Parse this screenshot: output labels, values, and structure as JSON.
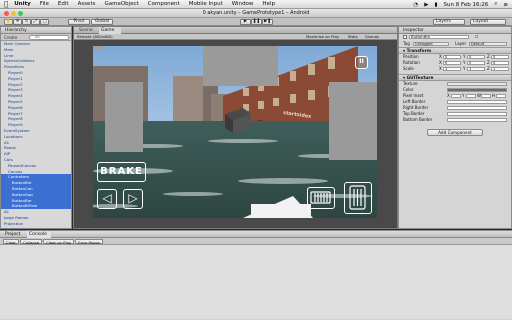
{
  "menubar": {
    "items": [
      "Unity",
      "File",
      "Edit",
      "Assets",
      "GameObject",
      "Component",
      "Mobile Input",
      "Window",
      "Help"
    ],
    "clock": "Sun 8 Feb 16:26"
  },
  "window": {
    "title": "0 akyan.unity – GamePrototype1 – Android"
  },
  "toolbar": {
    "pivot_label": "Pivot",
    "global_label": "Global",
    "layers_label": "Layers",
    "layout_label": "Layout"
  },
  "hierarchy": {
    "tab": "Hierarchy",
    "create_label": "Create",
    "search_placeholder": "All",
    "items": [
      {
        "label": "Main Camera",
        "indent": 0,
        "selected": false
      },
      {
        "label": "Main",
        "indent": 0,
        "selected": false
      },
      {
        "label": "Lime",
        "indent": 0,
        "selected": false
      },
      {
        "label": "SphereColliders",
        "indent": 0,
        "selected": false
      },
      {
        "label": "Planetlans",
        "indent": 0,
        "selected": false
      },
      {
        "label": "Player0",
        "indent": 1,
        "selected": false
      },
      {
        "label": "Player1",
        "indent": 1,
        "selected": false
      },
      {
        "label": "Player2",
        "indent": 1,
        "selected": false
      },
      {
        "label": "Player3",
        "indent": 1,
        "selected": false
      },
      {
        "label": "Player4",
        "indent": 1,
        "selected": false
      },
      {
        "label": "Player5",
        "indent": 1,
        "selected": false
      },
      {
        "label": "Player6",
        "indent": 1,
        "selected": false
      },
      {
        "label": "Player7",
        "indent": 1,
        "selected": false
      },
      {
        "label": "Player8",
        "indent": 1,
        "selected": false
      },
      {
        "label": "Player9",
        "indent": 1,
        "selected": false
      },
      {
        "label": "EventSystem",
        "indent": 0,
        "selected": false
      },
      {
        "label": "Locations",
        "indent": 0,
        "selected": false
      },
      {
        "label": "A1",
        "indent": 0,
        "selected": false
      },
      {
        "label": "Roads",
        "indent": 0,
        "selected": false
      },
      {
        "label": "AIP",
        "indent": 0,
        "selected": false
      },
      {
        "label": "Cars",
        "indent": 0,
        "selected": false
      },
      {
        "label": "PausedCanvas",
        "indent": 1,
        "selected": false
      },
      {
        "label": "Canvas",
        "indent": 1,
        "selected": false
      },
      {
        "label": "Controllers",
        "indent": 1,
        "selected": true
      },
      {
        "label": "ButtonBrk",
        "indent": 2,
        "selected": true
      },
      {
        "label": "ButtonCon",
        "indent": 2,
        "selected": true
      },
      {
        "label": "ButtonGap",
        "indent": 2,
        "selected": true
      },
      {
        "label": "ButtonBor",
        "indent": 2,
        "selected": true
      },
      {
        "label": "ButtonBlFree",
        "indent": 2,
        "selected": true
      },
      {
        "label": "A1",
        "indent": 0,
        "selected": false
      },
      {
        "label": "Jorge Ramos",
        "indent": 0,
        "selected": false
      },
      {
        "label": "Projection",
        "indent": 0,
        "selected": false
      },
      {
        "label": "Sparks",
        "indent": 0,
        "selected": false
      }
    ]
  },
  "gameview": {
    "tabs": [
      "Scene",
      "Game"
    ],
    "aspect_label": "Remote (800x480)",
    "maximize_label": "Maximize on Play",
    "stats_label": "Stats",
    "gizmos_label": "Gizmos",
    "hud": {
      "brake_label": "BRAKE",
      "left_arrow": "◁",
      "right_arrow": "▷",
      "pause_symbol": "II",
      "store_sign": "startsides"
    }
  },
  "inspector": {
    "tab": "Inspector",
    "name_value": "ButtonBrk",
    "tag_label": "Tag",
    "tag_value": "Untagged",
    "layer_label": "Layer",
    "layer_value": "Default",
    "transform_title": "Transform",
    "rows": [
      {
        "label": "Position",
        "x": "0",
        "y": "0",
        "z": "0"
      },
      {
        "label": "Rotation",
        "x": "0",
        "y": "0",
        "z": "0"
      },
      {
        "label": "Scale",
        "x": "1",
        "y": "1",
        "z": "1"
      }
    ],
    "gui_title": "GUITexture",
    "gui_rows": [
      "Texture",
      "Color",
      "Pixel Inset",
      "Left Border",
      "Right Border",
      "Top Border",
      "Bottom Border"
    ],
    "pixel_inset": {
      "x": "X",
      "y": "Y",
      "w": "W",
      "h": "H"
    },
    "add_component_label": "Add Component"
  },
  "console": {
    "tabs": [
      "Project",
      "Console"
    ],
    "buttons": [
      "Clear",
      "Collapse",
      "Clear on Play",
      "Error Pause"
    ]
  },
  "colors": {
    "selection": "#3b6fd1",
    "hierarchy_text": "#1a3c8a",
    "panel_bg": "#d5d5d5",
    "workspace": "#2b2b2b"
  }
}
